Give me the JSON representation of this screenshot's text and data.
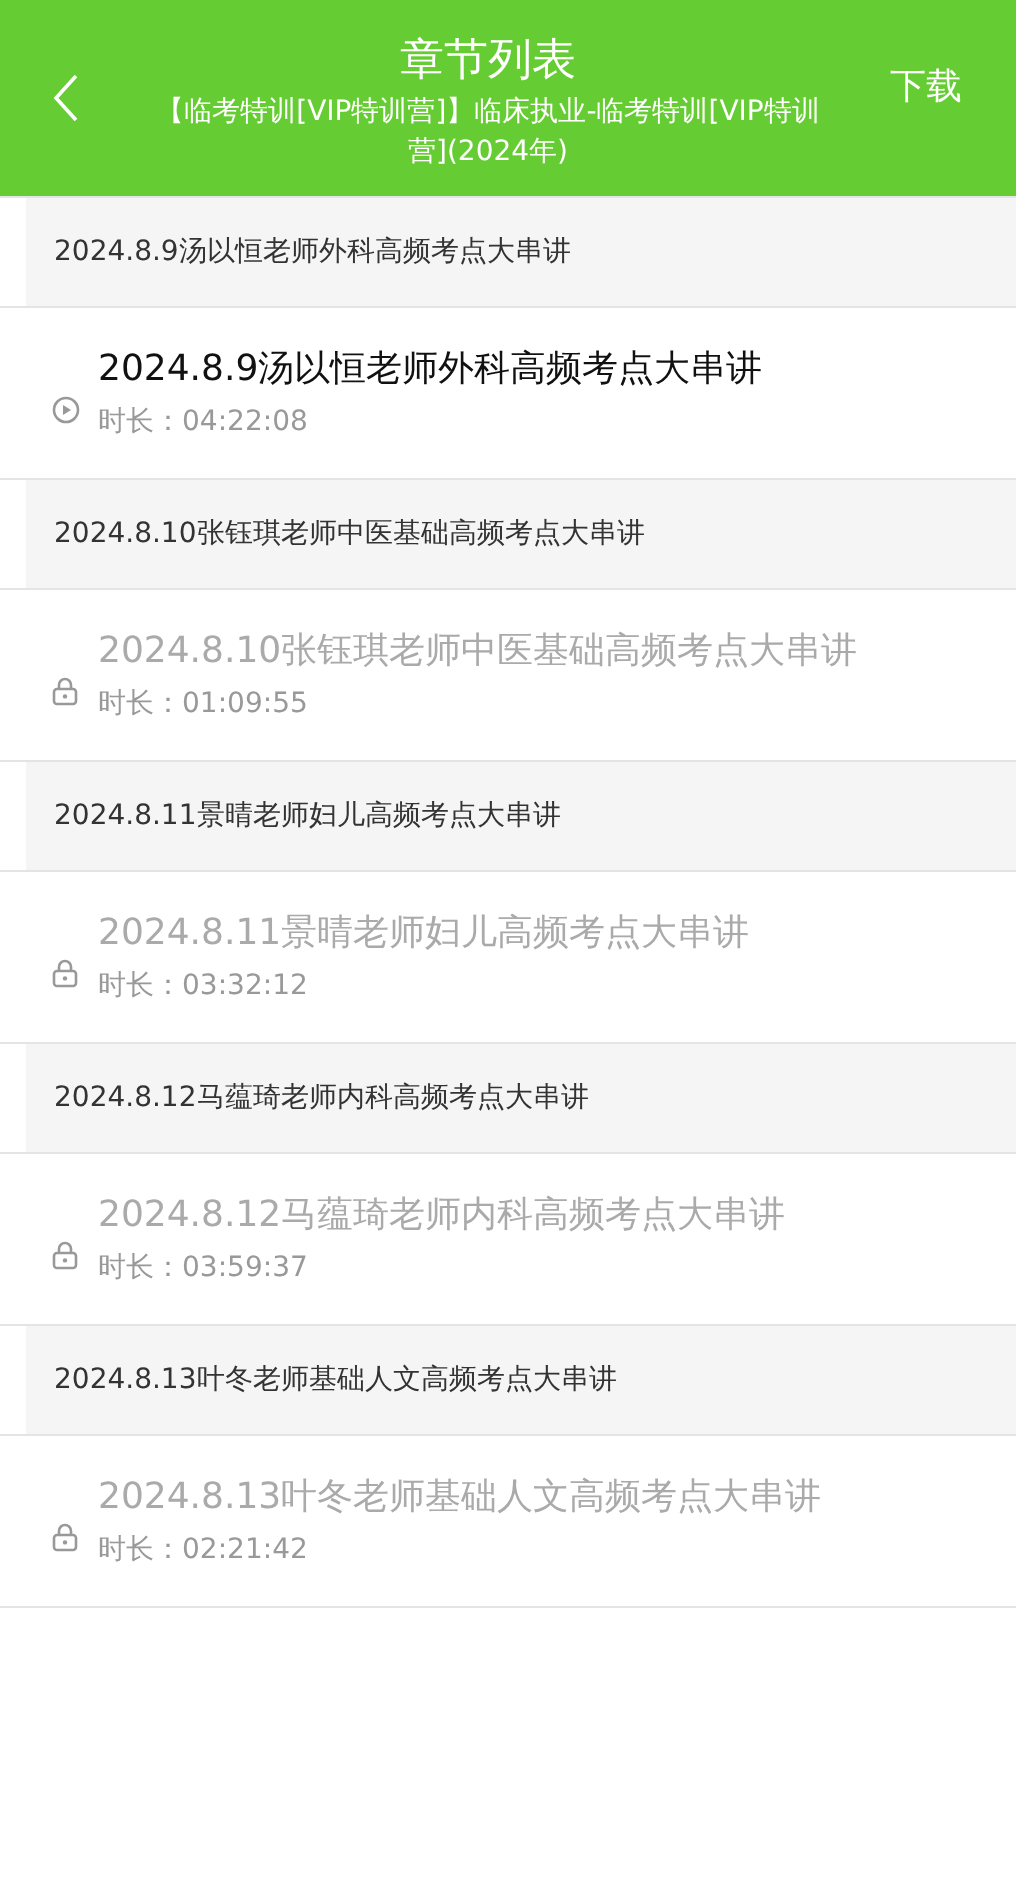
{
  "header": {
    "title": "章节列表",
    "subtitle": "【临考特训[VIP特训营]】临床执业-临考特训[VIP特训营](2024年)",
    "action": "下载"
  },
  "chapters": [
    {
      "heading": "2024.8.9汤以恒老师外科高频考点大串讲",
      "lesson": {
        "title": "2024.8.9汤以恒老师外科高频考点大串讲",
        "duration": "时长：04:22:08",
        "locked": false
      }
    },
    {
      "heading": "2024.8.10张钰琪老师中医基础高频考点大串讲",
      "lesson": {
        "title": "2024.8.10张钰琪老师中医基础高频考点大串讲",
        "duration": "时长：01:09:55",
        "locked": true
      }
    },
    {
      "heading": "2024.8.11景晴老师妇儿高频考点大串讲",
      "lesson": {
        "title": "2024.8.11景晴老师妇儿高频考点大串讲",
        "duration": "时长：03:32:12",
        "locked": true
      }
    },
    {
      "heading": "2024.8.12马蕴琦老师内科高频考点大串讲",
      "lesson": {
        "title": "2024.8.12马蕴琦老师内科高频考点大串讲",
        "duration": "时长：03:59:37",
        "locked": true
      }
    },
    {
      "heading": "2024.8.13叶冬老师基础人文高频考点大串讲",
      "lesson": {
        "title": "2024.8.13叶冬老师基础人文高频考点大串讲",
        "duration": "时长：02:21:42",
        "locked": true
      }
    }
  ]
}
